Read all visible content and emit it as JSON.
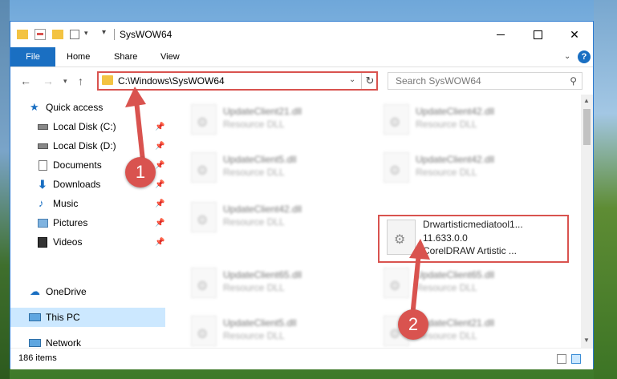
{
  "window": {
    "title": "SysWOW64",
    "ribbon_tabs": [
      "File",
      "Home",
      "Share",
      "View"
    ],
    "help": "?"
  },
  "address": {
    "path": "C:\\Windows\\SysWOW64"
  },
  "search": {
    "placeholder": "Search SysWOW64"
  },
  "nav": {
    "items": [
      {
        "label": "Quick access",
        "icon": "star-icon",
        "pinned": false
      },
      {
        "label": "Local Disk (C:)",
        "icon": "drive-icon",
        "pinned": true
      },
      {
        "label": "Local Disk (D:)",
        "icon": "drive-icon",
        "pinned": true
      },
      {
        "label": "Documents",
        "icon": "documents-icon",
        "pinned": true
      },
      {
        "label": "Downloads",
        "icon": "download-icon",
        "pinned": true
      },
      {
        "label": "Music",
        "icon": "music-icon",
        "pinned": true
      },
      {
        "label": "Pictures",
        "icon": "pictures-icon",
        "pinned": true
      },
      {
        "label": "Videos",
        "icon": "videos-icon",
        "pinned": true
      },
      {
        "label": "OneDrive",
        "icon": "cloud-icon",
        "pinned": false
      },
      {
        "label": "This PC",
        "icon": "computer-icon",
        "pinned": false
      },
      {
        "label": "Network",
        "icon": "network-icon",
        "pinned": false
      }
    ]
  },
  "files": [
    {
      "name": "UpdateClient21.dll",
      "sub": "Resource DLL"
    },
    {
      "name": "UpdateClient42.dll",
      "sub": "Resource DLL"
    },
    {
      "name": "UpdateClient5.dll",
      "sub": "Resource DLL"
    },
    {
      "name": "UpdateClient42.dll",
      "sub": "Resource DLL"
    },
    {
      "name": "UpdateClient42.dll",
      "sub": "Resource DLL"
    },
    {
      "name": "Drwartisticmediatool1...",
      "sub": "11.633.0.0",
      "sub2": "CorelDRAW Artistic ..."
    },
    {
      "name": "UpdateClient65.dll",
      "sub": "Resource DLL"
    },
    {
      "name": "UpdateClient65.dll",
      "sub": "Resource DLL"
    },
    {
      "name": "UpdateClient5.dll",
      "sub": "Resource DLL"
    },
    {
      "name": "UpdateClient21.dll",
      "sub": "Resource DLL"
    }
  ],
  "status": {
    "items_count": "186 items"
  },
  "callouts": [
    "1",
    "2"
  ],
  "colors": {
    "accent": "#1a6fc2",
    "highlight": "#d9534f",
    "selected_nav": "#cce8ff"
  }
}
